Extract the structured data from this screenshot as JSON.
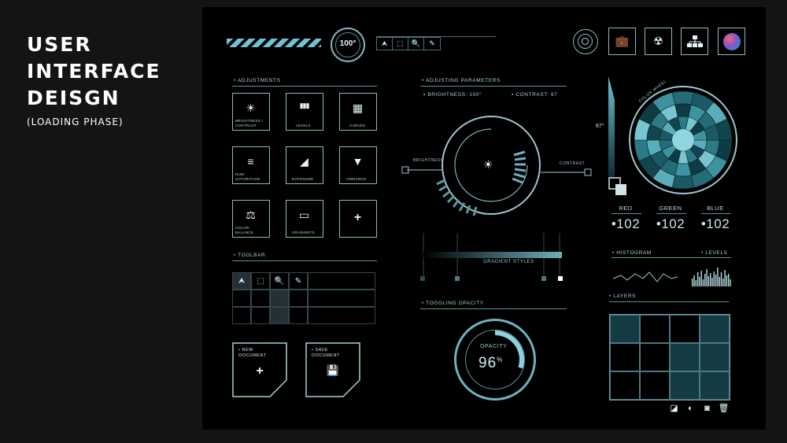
{
  "side": {
    "line1": "USER",
    "line2": "INTERFACE",
    "line3": "DEISGN",
    "subtitle": "(LOADING PHASE)"
  },
  "top": {
    "gauge_value": "100°",
    "tools": [
      "⮝",
      "⬚",
      "🔍",
      "✎"
    ],
    "buttons": [
      {
        "name": "briefcase-icon",
        "glyph": "💼"
      },
      {
        "name": "radiation-icon",
        "glyph": "☢"
      },
      {
        "name": "hierarchy-icon",
        "glyph": "⧉"
      },
      {
        "name": "color-orb-icon",
        "glyph": ""
      }
    ]
  },
  "adjustments": {
    "header": "ADJUSTMENTS",
    "items": [
      {
        "label": "BRIGHTNESS / CONTRAST",
        "glyph": "☀"
      },
      {
        "label": "LEVELS",
        "glyph": "▮▮▮"
      },
      {
        "label": "CURVES",
        "glyph": "▦"
      },
      {
        "label": "HUE/ SATURATION",
        "glyph": "≡"
      },
      {
        "label": "EXPOSURE",
        "glyph": "◢"
      },
      {
        "label": "VIBRANCE",
        "glyph": "▼"
      },
      {
        "label": "COLOR BALANCE",
        "glyph": "⚖"
      },
      {
        "label": "GRADIENTS",
        "glyph": "▭"
      },
      {
        "label": "",
        "glyph": "+"
      }
    ]
  },
  "toolbar": {
    "header": "TOOLBAR",
    "tools": [
      "⮝",
      "⬚",
      "🔍",
      "✎"
    ]
  },
  "documents": {
    "new_line1": "NEW",
    "new_line2": "DOCUMENT",
    "new_glyph": "+",
    "save_line1": "SAVE",
    "save_line2": "DOCUMENT",
    "save_glyph": "💾"
  },
  "params": {
    "header": "ADJUSTING PARAMETERS",
    "brightness": "BRIGHTNESS: 100°",
    "contrast": "CONTRAST: 67",
    "left_label": "BRIGHTNESS",
    "right_label": "CONTRAST",
    "gradient_label": "GRADIENT STYLES",
    "brightness_value": 100,
    "contrast_value": 67
  },
  "opacity": {
    "header": "TOGGLING OPACITY",
    "label": "OPACITY",
    "value": "96",
    "unit": "%",
    "fraction": 0.96
  },
  "color": {
    "wheel_label": "COLOR WHEEL",
    "angle": "67°",
    "accent": "#6fc3d3",
    "channels": [
      {
        "name": "RED",
        "value": "102"
      },
      {
        "name": "GREEN",
        "value": "102"
      },
      {
        "name": "BLUE",
        "value": "102"
      }
    ]
  },
  "histogram": {
    "left": "HISTOGRAM",
    "right": "LEVELS"
  },
  "layers": {
    "header": "LAYERS"
  }
}
